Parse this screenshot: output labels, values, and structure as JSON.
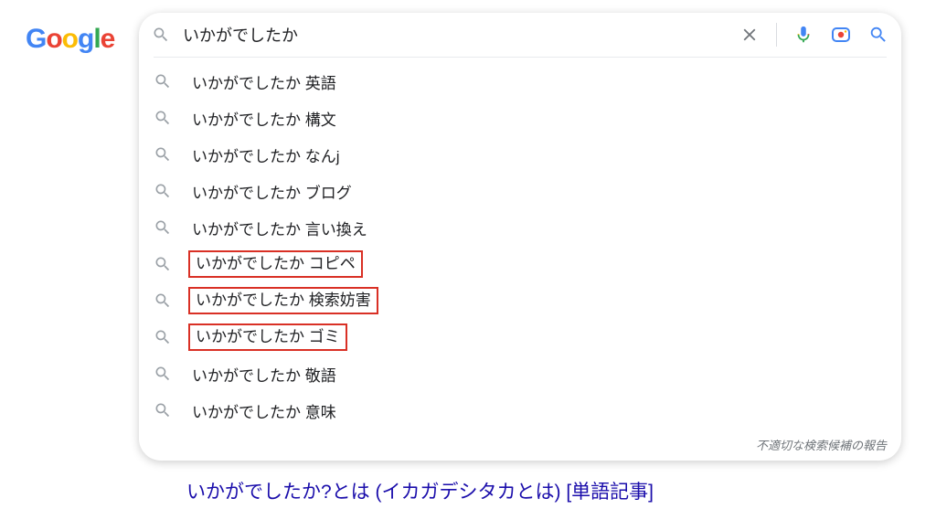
{
  "logo": {
    "letters": [
      {
        "t": "G",
        "c": "#4285F4"
      },
      {
        "t": "o",
        "c": "#EA4335"
      },
      {
        "t": "o",
        "c": "#FBBC05"
      },
      {
        "t": "g",
        "c": "#4285F4"
      },
      {
        "t": "l",
        "c": "#34A853"
      },
      {
        "t": "e",
        "c": "#EA4335"
      }
    ]
  },
  "search": {
    "value": "いかがでしたか "
  },
  "suggestions": [
    {
      "text": "いかがでしたか 英語",
      "highlight": false
    },
    {
      "text": "いかがでしたか 構文",
      "highlight": false
    },
    {
      "text": "いかがでしたか なんj",
      "highlight": false
    },
    {
      "text": "いかがでしたか ブログ",
      "highlight": false
    },
    {
      "text": "いかがでしたか 言い換え",
      "highlight": false
    },
    {
      "text": "いかがでしたか コピペ",
      "highlight": true
    },
    {
      "text": "いかがでしたか 検索妨害",
      "highlight": true
    },
    {
      "text": "いかがでしたか ゴミ",
      "highlight": true
    },
    {
      "text": "いかがでしたか 敬語",
      "highlight": false
    },
    {
      "text": "いかがでしたか 意味",
      "highlight": false
    }
  ],
  "report_label": "不適切な検索候補の報告",
  "result_below": "いかがでしたか?とは (イカガデシタカとは) [単語記事]"
}
